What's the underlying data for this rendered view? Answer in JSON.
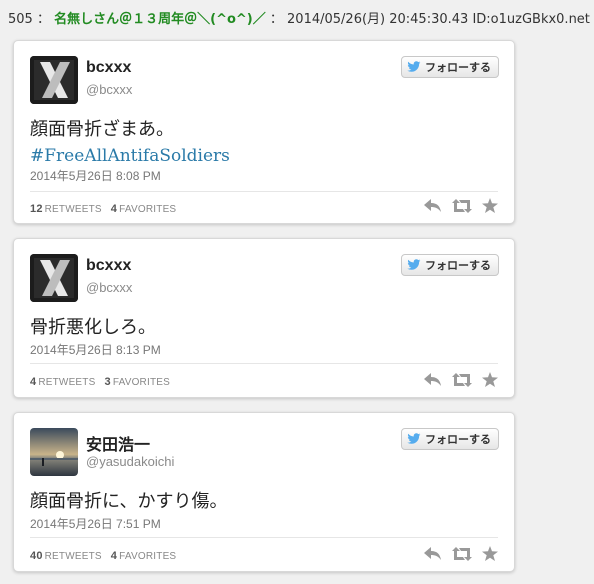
{
  "post": {
    "number": "505",
    "sep1": "：",
    "name": "名無しさん＠１３周年＠＼(^o^)／",
    "sep2": "：",
    "datetime": "2014/05/26(月) 20:45:30.43",
    "id": "ID:o1uzGBkx0.net"
  },
  "tweets": [
    {
      "display_name": "bcxxx",
      "screen_name": "@bcxxx",
      "follow_label": "フォローする",
      "text": "顔面骨折ざまあ。",
      "hashtag": "#FreeAllAntifaSoldiers",
      "timestamp": "2014年5月26日 8:08 PM",
      "retweets": "12",
      "retweets_label": "RETWEETS",
      "favorites": "4",
      "favorites_label": "FAVORITES",
      "avatar": "x-logo"
    },
    {
      "display_name": "bcxxx",
      "screen_name": "@bcxxx",
      "follow_label": "フォローする",
      "text": "骨折悪化しろ。",
      "timestamp": "2014年5月26日 8:13 PM",
      "retweets": "4",
      "retweets_label": "RETWEETS",
      "favorites": "3",
      "favorites_label": "FAVORITES",
      "avatar": "x-logo"
    },
    {
      "display_name": "安田浩一",
      "screen_name": "@yasudakoichi",
      "follow_label": "フォローする",
      "text": "顔面骨折に、かすり傷。",
      "timestamp": "2014年5月26日 7:51 PM",
      "retweets": "40",
      "retweets_label": "RETWEETS",
      "favorites": "4",
      "favorites_label": "FAVORITES",
      "avatar": "sunset-photo"
    }
  ],
  "icons": {
    "follow": "twitter-bird-icon",
    "reply": "reply-icon",
    "retweet": "retweet-icon",
    "favorite": "star-icon"
  },
  "colors": {
    "name_green": "#228b22",
    "hashtag_blue": "#2a7aa8",
    "twitter_blue": "#55acee"
  }
}
